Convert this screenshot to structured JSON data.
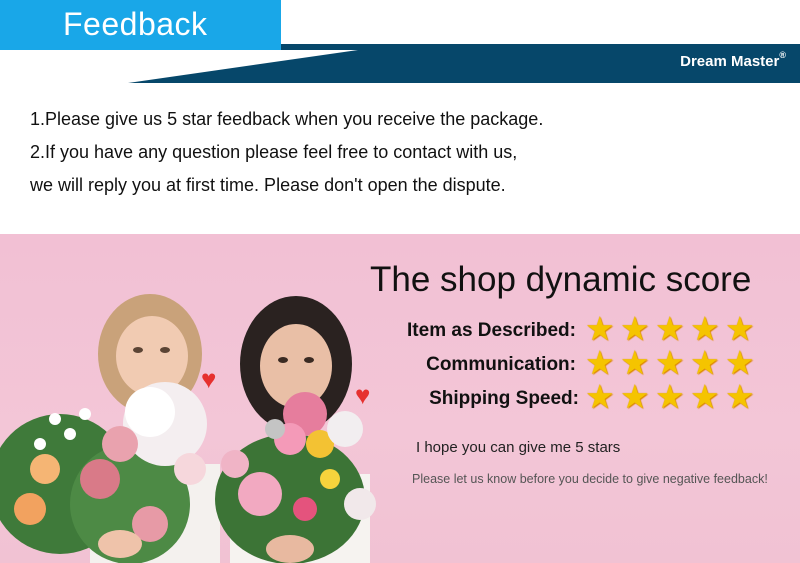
{
  "header": {
    "tab_label": "Feedback",
    "brand_name": "Dream Master",
    "brand_mark": "®"
  },
  "notes": [
    "1.Please give us 5 star feedback when you receive the package.",
    "2.If you have any question please feel free to contact with us,",
    "we will reply you at first time. Please don't open the dispute."
  ],
  "score": {
    "title": "The shop dynamic score",
    "items": [
      {
        "label": "Item as Described:",
        "stars": 5,
        "max_stars": 5
      },
      {
        "label": "Communication:",
        "stars": 5,
        "max_stars": 5
      },
      {
        "label": "Shipping Speed:",
        "stars": 5,
        "max_stars": 5
      }
    ],
    "star_icon": "star-icon"
  },
  "footer": {
    "hope_text": "I hope you can give me 5 stars",
    "disclaimer": "Please let us know before you decide to give negative feedback!"
  },
  "colors": {
    "tab_blue": "#19a7e8",
    "band_navy": "#06476a",
    "pink_bg": "#f3c6d7",
    "star_gold": "#f5c400",
    "heart_red": "#e6312f"
  }
}
